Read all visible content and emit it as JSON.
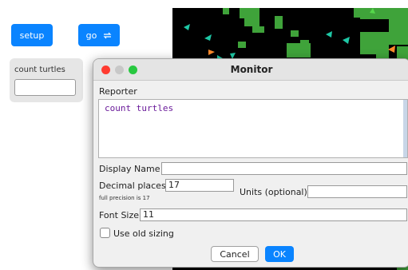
{
  "toolbar": {
    "setup_label": "setup",
    "go_label": "go",
    "go_icon": "forever-loop-icon"
  },
  "monitor_widget": {
    "label": "count turtles",
    "value": ""
  },
  "dialog": {
    "title": "Monitor",
    "reporter_label": "Reporter",
    "reporter_code": "count turtles",
    "display_name_label": "Display Name",
    "display_name_value": "",
    "decimal_places_label": "Decimal places",
    "decimal_places_value": "17",
    "full_precision_note": "full precision is 17",
    "units_label": "Units (optional)",
    "units_value": "",
    "font_size_label": "Font Size",
    "font_size_value": "11",
    "old_sizing_label": "Use old sizing",
    "old_sizing_checked": false,
    "cancel_label": "Cancel",
    "ok_label": "OK"
  },
  "colors": {
    "accent": "#0a84ff",
    "close_light": "#ff3b30",
    "minimize_light": "#c8c8c8",
    "zoom_light": "#28c840",
    "patch_green": "#3fa33a",
    "world_black": "#000000",
    "turtle_teal": "#1ec7a5",
    "turtle_orange": "#ff8a2b",
    "turtle_green": "#55d84a"
  }
}
